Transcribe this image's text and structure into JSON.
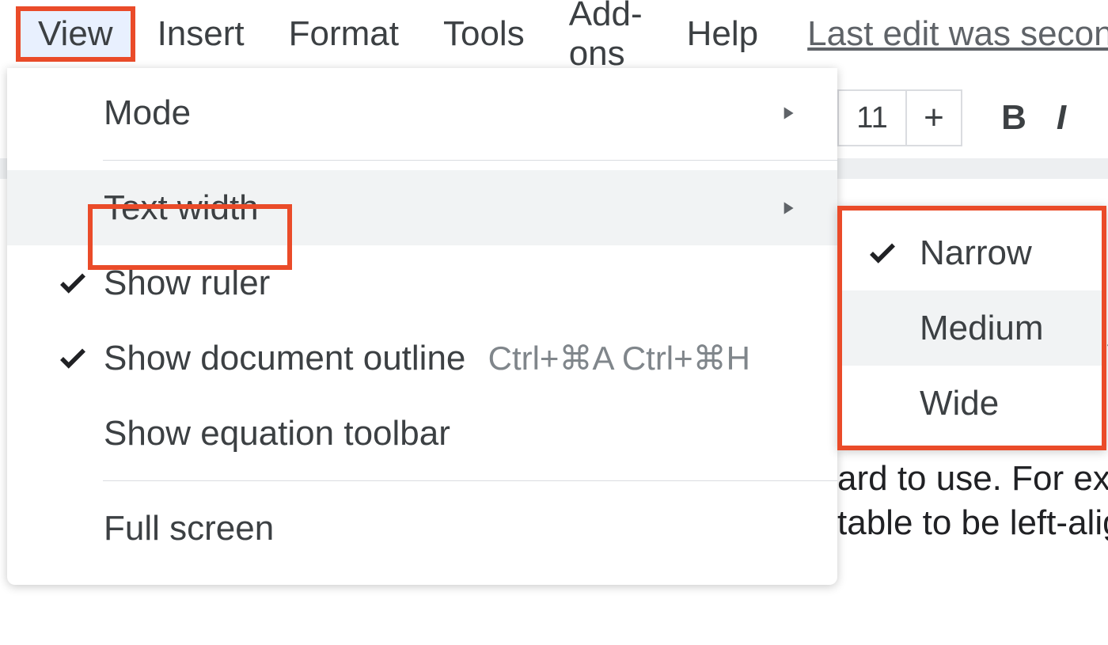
{
  "menubar": {
    "items": [
      "View",
      "Insert",
      "Format",
      "Tools",
      "Add-ons",
      "Help"
    ],
    "active_index": 0,
    "last_edit": "Last edit was seconds"
  },
  "toolbar": {
    "font_size": "11",
    "plus": "+",
    "bold": "B",
    "italic": "I"
  },
  "view_menu": {
    "items": [
      {
        "label": "Mode",
        "checked": false,
        "submenu": true,
        "shortcut": ""
      },
      {
        "label": "Text width",
        "checked": false,
        "submenu": true,
        "shortcut": "",
        "hover": true,
        "highlighted": true
      },
      {
        "label": "Show ruler",
        "checked": true,
        "submenu": false,
        "shortcut": ""
      },
      {
        "label": "Show document outline",
        "checked": true,
        "submenu": false,
        "shortcut": "Ctrl+⌘A Ctrl+⌘H"
      },
      {
        "label": "Show equation toolbar",
        "checked": false,
        "submenu": false,
        "shortcut": ""
      },
      {
        "label": "Full screen",
        "checked": false,
        "submenu": false,
        "shortcut": ""
      }
    ],
    "separators_after": [
      0,
      4
    ]
  },
  "text_width_submenu": {
    "items": [
      {
        "label": "Narrow",
        "checked": true,
        "hover": false
      },
      {
        "label": "Medium",
        "checked": false,
        "hover": true
      },
      {
        "label": "Wide",
        "checked": false,
        "hover": false
      }
    ]
  },
  "doc_bg": {
    "line1": "s",
    "line2": "ard to use. For exa",
    "line3": "table to be left-alig"
  }
}
